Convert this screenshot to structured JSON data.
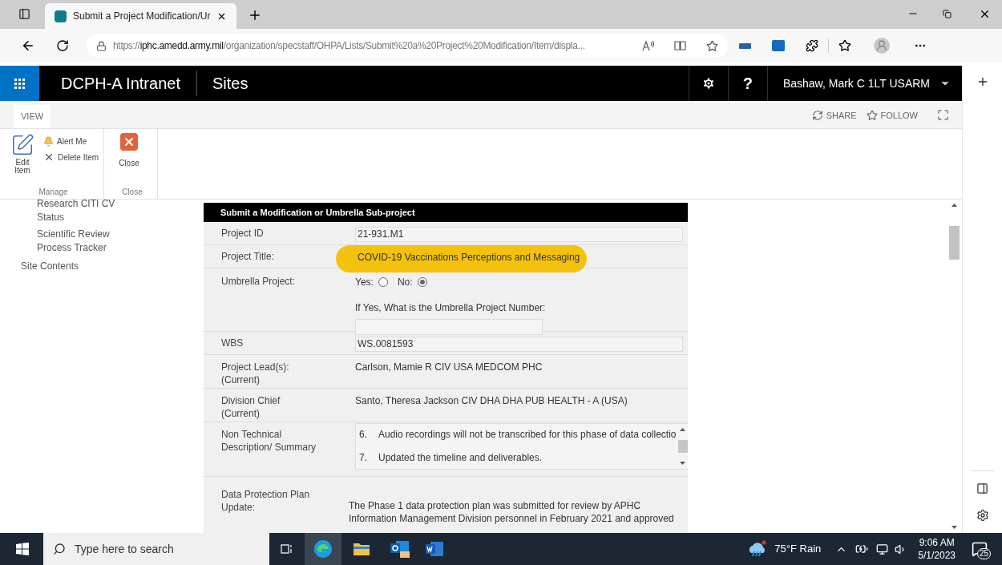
{
  "browser": {
    "tab_title": "Submit a Project Modification/Ur",
    "url": {
      "scheme": "https://",
      "host": "iphc.amedd.army.mil",
      "path": "/organization/specstaff/OHPA/Lists/Submit%20a%20Project%20Modification/Item/displa..."
    }
  },
  "suite_bar": {
    "app_title": "DCPH-A Intranet",
    "site": "Sites",
    "help": "?",
    "user": "Bashaw, Mark C 1LT USARM"
  },
  "ribbon": {
    "tabs": [
      {
        "label": "VIEW",
        "selected": true
      }
    ],
    "actions": [
      {
        "kind": "share",
        "label": "SHARE"
      },
      {
        "kind": "follow",
        "label": "FOLLOW"
      }
    ],
    "groups": [
      {
        "label": "Manage",
        "items": [
          {
            "kind": "edit",
            "label": "Edit Item"
          },
          {
            "kind": "alert",
            "label": "Alert Me"
          },
          {
            "kind": "delete",
            "label": "Delete Item"
          }
        ]
      },
      {
        "label": "Close",
        "items": [
          {
            "kind": "close",
            "label": "Close"
          }
        ]
      }
    ]
  },
  "nav": {
    "sub_items": [
      "Research CITI CV Status",
      "Scientific Review Process Tracker"
    ],
    "items": [
      "Site Contents"
    ]
  },
  "form": {
    "title": "Submit a Modification or Umbrella Sub-project",
    "rows": [
      {
        "kind": "input",
        "label": "Project ID",
        "value": "21-931.M1",
        "highlighted": false
      },
      {
        "kind": "input",
        "label": "Project Title:",
        "value": "COVID-19 Vaccinations Perceptions and Messaging",
        "highlighted": true
      },
      {
        "kind": "radio",
        "label": "Umbrella Project:",
        "options": [
          {
            "label": "Yes:",
            "selected": false
          },
          {
            "label": "No:",
            "selected": true
          }
        ],
        "sub_label": "If Yes, What is the Umbrella Project Number:"
      },
      {
        "kind": "input",
        "label": "WBS",
        "value": "WS.0081593",
        "highlighted": false
      },
      {
        "kind": "text",
        "label": "Project Lead(s): (Current)",
        "value": "Carlson, Mamie R CIV USA MEDCOM PHC"
      },
      {
        "kind": "text",
        "label": "Division Chief (Current)",
        "value": "Santo, Theresa Jackson CIV DHA DHA PUB HEALTH - A (USA)"
      },
      {
        "kind": "list",
        "label": "Non Technical Description/ Summary",
        "items": [
          {
            "num": "6.",
            "text": "Audio recordings will not be transcribed for this phase of data collectio"
          },
          {
            "num": "7.",
            "text": "Updated the timeline and deliverables."
          }
        ]
      },
      {
        "kind": "paragraph",
        "label": "Data Protection Plan Update:",
        "value": "The Phase 1 data protection plan was submitted for review by APHC Information Management Division personnel in February 2021 and approved"
      }
    ]
  },
  "taskbar": {
    "search_placeholder": "Type here to search",
    "weather": "75°F Rain",
    "time": "9:06 AM",
    "date": "5/1/2023",
    "notifications": "25"
  }
}
